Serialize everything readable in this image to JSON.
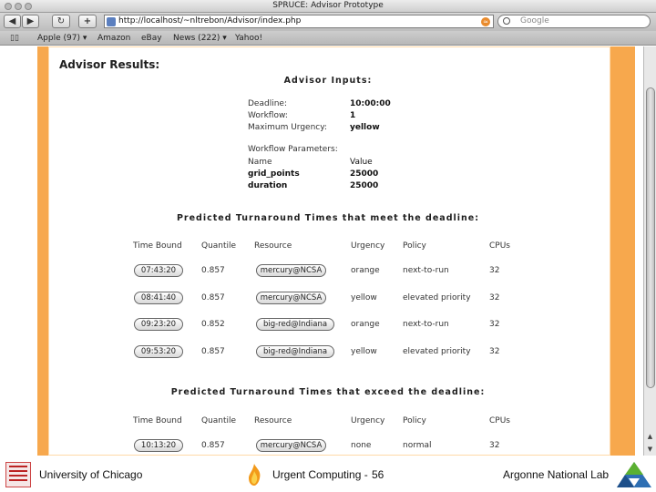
{
  "browser": {
    "window_title": "SPRUCE: Advisor Prototype",
    "nav": {
      "back": "◀",
      "forward": "▶",
      "reload": "↻",
      "add": "+"
    },
    "url": "http://localhost/~nltrebon/Advisor/index.php",
    "search_placeholder": "Google",
    "bookmarks": [
      "Apple (97) ▾",
      "Amazon",
      "eBay",
      "News (222) ▾",
      "Yahoo!"
    ]
  },
  "page": {
    "heading": "Advisor Results:",
    "inputs": {
      "heading": "Advisor Inputs:",
      "deadline_label": "Deadline:",
      "deadline_value": "10:00:00",
      "workflow_label": "Workflow:",
      "workflow_value": "1",
      "urgency_label": "Maximum Urgency:",
      "urgency_value": "yellow",
      "params_heading": "Workflow Parameters:",
      "params_name_header": "Name",
      "params_value_header": "Value",
      "params": [
        {
          "name": "grid_points",
          "value": "25000"
        },
        {
          "name": "duration",
          "value": "25000"
        }
      ]
    },
    "meet_table": {
      "heading": "Predicted Turnaround Times that meet the deadline:",
      "columns": [
        "Time Bound",
        "Quantile",
        "Resource",
        "Urgency",
        "Policy",
        "CPUs"
      ],
      "rows": [
        {
          "time": "07:43:20",
          "quantile": "0.857",
          "resource": "mercury@NCSA",
          "urgency": "orange",
          "policy": "next-to-run",
          "cpus": "32"
        },
        {
          "time": "08:41:40",
          "quantile": "0.857",
          "resource": "mercury@NCSA",
          "urgency": "yellow",
          "policy": "elevated priority",
          "cpus": "32"
        },
        {
          "time": "09:23:20",
          "quantile": "0.852",
          "resource": "big-red@Indiana",
          "urgency": "orange",
          "policy": "next-to-run",
          "cpus": "32"
        },
        {
          "time": "09:53:20",
          "quantile": "0.857",
          "resource": "big-red@Indiana",
          "urgency": "yellow",
          "policy": "elevated priority",
          "cpus": "32"
        }
      ]
    },
    "exceed_table": {
      "heading": "Predicted Turnaround Times that exceed the deadline:",
      "columns": [
        "Time Bound",
        "Quantile",
        "Resource",
        "Urgency",
        "Policy",
        "CPUs"
      ],
      "rows": [
        {
          "time": "10:13:20",
          "quantile": "0.857",
          "resource": "mercury@NCSA",
          "urgency": "none",
          "policy": "normal",
          "cpus": "32"
        }
      ]
    }
  },
  "footer": {
    "left": "University of Chicago",
    "center": "Urgent Computing -",
    "page_number": "56",
    "right": "Argonne National Lab"
  },
  "colors": {
    "orange_border": "#f7a84d",
    "pill_border": "#666666"
  }
}
